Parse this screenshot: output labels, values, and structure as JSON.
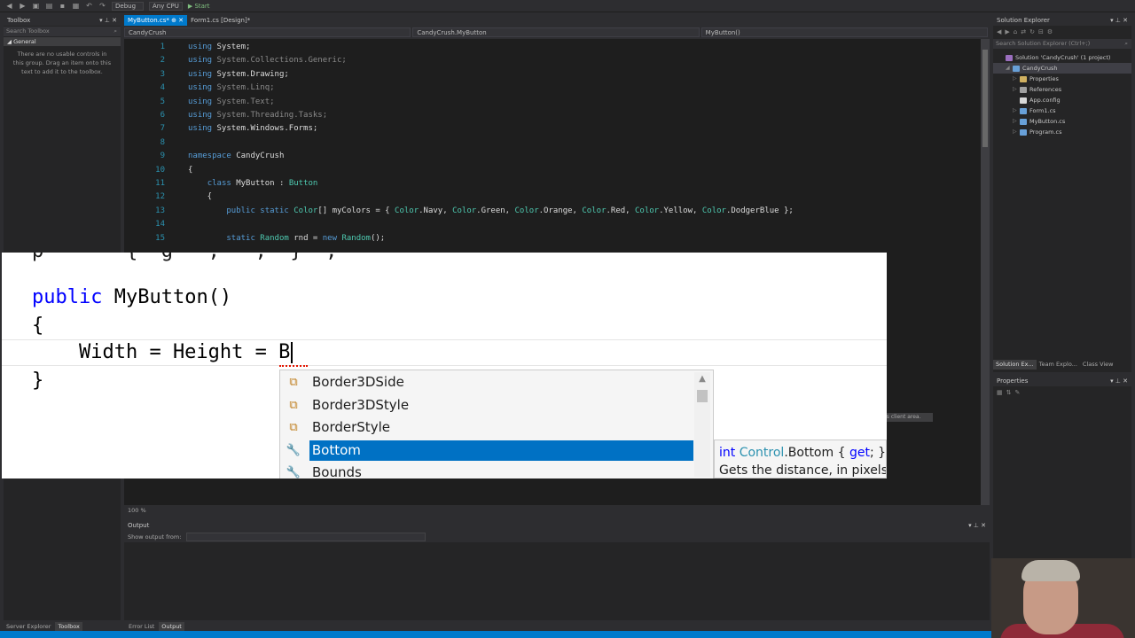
{
  "toolbar": {
    "config": "Debug",
    "platform": "Any CPU",
    "start": "Start"
  },
  "toolbox": {
    "title": "Toolbox",
    "search_placeholder": "Search Toolbox",
    "group": "General",
    "empty_message": "There are no usable controls in this group. Drag an item onto this text to add it to the toolbox."
  },
  "tabs": [
    {
      "label": "MyButton.cs*",
      "active": true
    },
    {
      "label": "Form1.cs [Design]*",
      "active": false
    }
  ],
  "navbar": {
    "project": "CandyCrush",
    "type": "CandyCrush.MyButton",
    "member": "MyButton()"
  },
  "code_lines": [
    {
      "n": "1",
      "text": "using System;"
    },
    {
      "n": "2",
      "text": "using System.Collections.Generic;"
    },
    {
      "n": "3",
      "text": "using System.Drawing;"
    },
    {
      "n": "4",
      "text": "using System.Linq;"
    },
    {
      "n": "5",
      "text": "using System.Text;"
    },
    {
      "n": "6",
      "text": "using System.Threading.Tasks;"
    },
    {
      "n": "7",
      "text": "using System.Windows.Forms;"
    },
    {
      "n": "8",
      "text": ""
    },
    {
      "n": "9",
      "text": "namespace CandyCrush"
    },
    {
      "n": "10",
      "text": "{"
    },
    {
      "n": "11",
      "text": "    class MyButton : Button"
    },
    {
      "n": "12",
      "text": "    {"
    },
    {
      "n": "13",
      "text": "        public static Color[] myColors = { Color.Navy, Color.Green, Color.Orange, Color.Red, Color.Yellow, Color.DodgerBlue };"
    },
    {
      "n": "14",
      "text": ""
    },
    {
      "n": "15",
      "text": "        static Random rnd = new Random();"
    }
  ],
  "zoom_level": "100 %",
  "output": {
    "title": "Output",
    "show_from_label": "Show output from:"
  },
  "bottom_left_tabs": [
    "Server Explorer",
    "Toolbox"
  ],
  "bottom_mid_tabs": [
    "Error List",
    "Output"
  ],
  "solution_explorer": {
    "title": "Solution Explorer",
    "search_placeholder": "Search Solution Explorer (Ctrl+;)",
    "items": [
      {
        "label": "Solution 'CandyCrush' (1 project)",
        "indent": 0
      },
      {
        "label": "CandyCrush",
        "indent": 1
      },
      {
        "label": "Properties",
        "indent": 2
      },
      {
        "label": "References",
        "indent": 2
      },
      {
        "label": "App.config",
        "indent": 2
      },
      {
        "label": "Form1.cs",
        "indent": 2
      },
      {
        "label": "MyButton.cs",
        "indent": 2
      },
      {
        "label": "Program.cs",
        "indent": 2
      }
    ],
    "tabs": [
      "Solution Ex...",
      "Team Explo...",
      "Class View"
    ]
  },
  "properties": {
    "title": "Properties"
  },
  "design_hint": "er's client area.",
  "zoom_overlay": {
    "line1_kw": "public",
    "line1_rest": " MyButton()",
    "line2": "{",
    "line3": "    Width = Height = B",
    "line4": "}",
    "cutoff": "p       {  g   ,   ,  }  ;"
  },
  "completion": {
    "items": [
      {
        "label": "Border3DSide",
        "icon": "enum-icon",
        "selected": false
      },
      {
        "label": "Border3DStyle",
        "icon": "enum-icon",
        "selected": false
      },
      {
        "label": "BorderStyle",
        "icon": "enum-icon",
        "selected": false
      },
      {
        "label": "Bottom",
        "icon": "property-wrench-icon",
        "selected": true
      },
      {
        "label": "Bounds",
        "icon": "property-wrench-icon",
        "selected": false
      }
    ],
    "tooltip_kw": "int",
    "tooltip_type": "Control",
    "tooltip_member": ".Bottom { ",
    "tooltip_get": "get",
    "tooltip_end": "; }",
    "tooltip_desc": "Gets the distance, in pixels,"
  }
}
